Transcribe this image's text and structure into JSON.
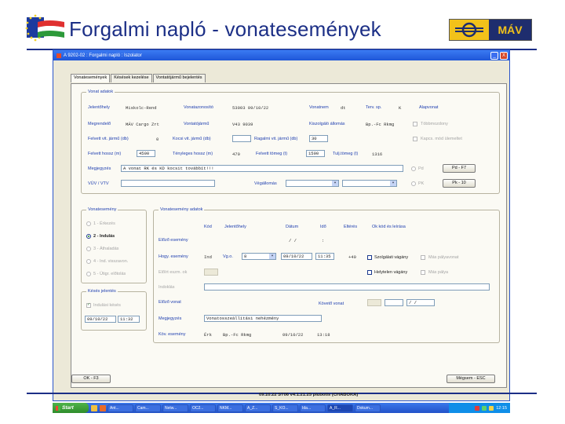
{
  "slide": {
    "title": "Forgalmi napló - vonatesemények",
    "mav_logo_text": "MÁV"
  },
  "window": {
    "title": "A 9202-02 : Forgalmi napló : Iszolator",
    "min": "_",
    "close": "X"
  },
  "tabs": [
    "Vonatesemények",
    "Késések kezelése",
    "Vontatójármű bejelentés"
  ],
  "vonat_adatok": {
    "legend": "Vonat adatok",
    "row1": {
      "jelentohely_label": "Jelentőhely",
      "jelentohely_value": "Miskolc-Rend",
      "vonatazonosito_label": "Vonatazonosító",
      "vonatazonosito_value": "53003 09/10/22",
      "vonatnem_label": "Vonatnem",
      "vonatnem_value": "dt",
      "terv_sp_label": "Terv. sp.",
      "terv_sp_value": "K",
      "alapvonat_label": "Alapvonat"
    },
    "row2": {
      "megrendelo_label": "Megrendelő",
      "megrendelo_value": "MÁV Cargo Zrt",
      "vontatojarmu_label": "Vontatójármű",
      "vontatojarmu_value": "V43 9039",
      "kiszolgalo_label": "Kiszolgáló állomás",
      "kiszolgalo_value": "Bp.-Fc Rkmg",
      "tobbmozdony_label": "Többmozdony"
    },
    "row3": {
      "felvett_tengely_label": "Felvett vit. jármű (db)",
      "felvett_tengely_value": "0",
      "kocsi_vit_label": "Kocsi vit. jármű (db)",
      "kocsi_vit_value": "",
      "ragalmi_label": "Ragalmi vit. jármű (db)",
      "ragalmi_value": "30",
      "kapcs_label": "Kapcs. mód ülemeltet"
    },
    "row4": {
      "felvett_hossz_label": "Felvett hossz (m)",
      "felvett_hossz_value": "4500",
      "tenyleges_hossz_label": "Tényleges hossz (m)",
      "tenyleges_hossz_value": "470",
      "felvett_tomeg_label": "Felvett tömeg (t)",
      "felvett_tomeg_value": "1500",
      "tenyl_tomeg_label": "Tulj.tömeg (t)",
      "tenyl_tomeg_value": "1316"
    },
    "megjegyzes_label": "Megjegyzés",
    "megjegyzes_value": "A vonat RK és KD kocsit továbbít!!!",
    "pd_label": "Pd",
    "pd_button": "Pd - F7",
    "vuv_label": "VÚV / VTV",
    "vuv_value": "",
    "vegallomas_label": "Végállomás",
    "vegallomas_value": "",
    "pk_label": "PK",
    "pk_button": "Pk - 10"
  },
  "vonatesemeny": {
    "legend": "Vonatesemény",
    "options": [
      "1 - Érkezés",
      "2 - Indulás",
      "3 - Áthaladás",
      "4 - Ind. visszavon.",
      "5 - Útigr. előtolás"
    ],
    "selected_index": 1
  },
  "esemeny_adatok": {
    "legend": "Vonatesemény adatok",
    "col_kod": "Kód",
    "col_jelentohely": "Jelentőhely",
    "col_datum": "Dátum",
    "col_ido": "Idő",
    "col_elteres": "Eltérés",
    "col_ok": "Ok kód és leírása",
    "elozo_label": "Előző esemény",
    "elozo_datum": "/   /",
    "elozo_ido": ":",
    "hogy_label": "Hogy. esemény",
    "hogy_kod": "Ind",
    "hogy_jelentohely": "Vg.o.",
    "hogy_combo": "8",
    "hogy_datum": "09/10/22",
    "hogy_ido": "11:35",
    "hogy_elteres": "+40",
    "eloiszt_label": "Előírt eszm. ok",
    "szolgalati_label": "Szolgálati vágány",
    "masik_label": "Más pályavonat",
    "helytelen_label": "Helytelen vágány",
    "masik2_label": "Más pálya",
    "indoklas_label": "Indoklás",
    "indoklas_value": "",
    "elozo_vonat_label": "Előző vonat",
    "koveteso_label": "Követő vonat",
    "koveteso_date": "/   /",
    "megjegyzes_label": "Megjegyzés",
    "megjegyzes_value": "Vonatosszeállitási nehézmény",
    "kov_label": "Köv. esemény",
    "kov_kod": "Érk",
    "kov_jelentohely": "Bp.-Fc Rkmg",
    "kov_datum": "09/10/22",
    "kov_ido": "13:18"
  },
  "keses": {
    "legend": "Késés jelentés",
    "indulasi_label": "Indulási késés",
    "datum": "09/10/22",
    "ido": "11:32"
  },
  "buttons": {
    "ok": "OK - F3",
    "megsem": "Mégsem - ESC"
  },
  "statusline": "09.10.22 ST06 v4.1.21.25 plubotis (CHABOKA)",
  "taskbar": {
    "start": "Start",
    "items": [
      "Ant...",
      "Cam...",
      "Netw...",
      "OC2...",
      "NKM...",
      "A_Z...",
      "S_KO...",
      "Ida...",
      "A_R...",
      "Dokum..."
    ],
    "clock": "12:15"
  }
}
